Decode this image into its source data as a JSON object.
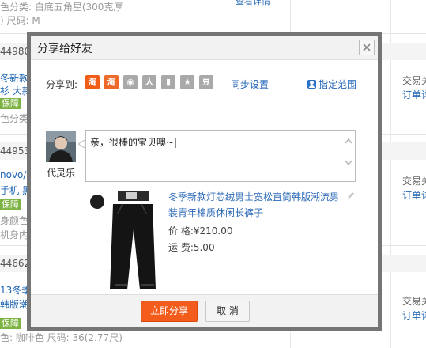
{
  "background": {
    "rows": [
      {
        "text": "色分类: 白底五角星(300克厚",
        "tone": "gray"
      },
      {
        "text": ") 尺码: M",
        "tone": "gray"
      },
      {
        "text": "44980",
        "tone": "num"
      },
      {
        "text": "冬新款",
        "tone": "blue"
      },
      {
        "text": "衫 大款",
        "tone": "blue"
      },
      {
        "text": "保障",
        "tone": "badge"
      },
      {
        "text": "色分类",
        "tone": "gray"
      },
      {
        "text": "44953",
        "tone": "num"
      },
      {
        "text": "novo/",
        "tone": "blue"
      },
      {
        "text": "手机 黑",
        "tone": "blue"
      },
      {
        "text": "保障",
        "tone": "badge"
      },
      {
        "text": "身颜色",
        "tone": "gray"
      },
      {
        "text": "机身内",
        "tone": "gray"
      },
      {
        "text": "44662",
        "tone": "num"
      },
      {
        "text": "13冬季",
        "tone": "blue"
      },
      {
        "text": "韩版潮",
        "tone": "blue"
      },
      {
        "text": "保障",
        "tone": "badge"
      },
      {
        "text": "色: 咖啡色  尺码: 36(2.77尺)",
        "tone": "gray"
      }
    ],
    "right_labels": [
      "交易关",
      "订单详",
      "交易关",
      "订单详",
      "交易关",
      "订单详"
    ]
  },
  "dialog": {
    "title": "分享给好友",
    "share_to_label": "分享到:",
    "platforms": [
      {
        "name": "taobao",
        "glyph": "淘",
        "color": "#f25c19"
      },
      {
        "name": "taobao2",
        "glyph": "淘",
        "color": "#ee6a2a"
      },
      {
        "name": "weibo",
        "glyph": "◉",
        "color": "#a9a9a9"
      },
      {
        "name": "renren",
        "glyph": "人",
        "color": "#a9a9a9"
      },
      {
        "name": "kaixin",
        "glyph": "▮",
        "color": "#a9a9a9"
      },
      {
        "name": "qzone",
        "glyph": "★",
        "color": "#a9a9a9"
      },
      {
        "name": "douban",
        "glyph": "豆",
        "color": "#a9a9a9"
      }
    ],
    "sync_settings_label": "同步设置",
    "scope_label": "指定范围",
    "user_name": "代灵乐",
    "message": "亲，很棒的宝贝噢~|",
    "product": {
      "title": "冬季新款灯芯绒男士宽松直筒韩版潮流男装青年棉质休闲长裤子",
      "price_label": "价 格:",
      "price": "¥210.00",
      "shipping_label": "运 费:",
      "shipping": "5.00"
    },
    "share_button": "立即分享",
    "cancel_button": "取 消"
  },
  "colors": {
    "accent": "#f45c1c",
    "link": "#2266bb"
  }
}
